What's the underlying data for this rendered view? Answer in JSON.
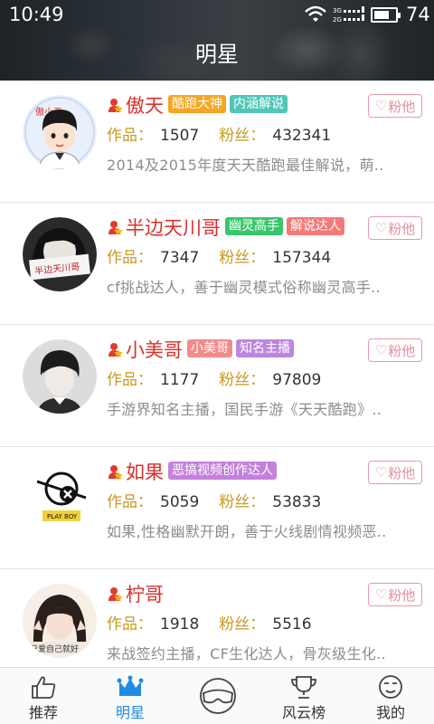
{
  "status_bar": {
    "time": "10:49",
    "network": "3G 2G",
    "battery": "74",
    "battery_level": 0.74
  },
  "header": {
    "title": "明星"
  },
  "stars": [
    {
      "name": "傲天",
      "tags": [
        {
          "label": "酷跑大神",
          "color": "#f5a623"
        },
        {
          "label": "内涵解说",
          "color": "#4fc6b8"
        }
      ],
      "works_label": "作品：",
      "works": "1507",
      "fans_label": "粉丝：",
      "fans": "432341",
      "desc": "2014及2015年度天天酷跑最佳解说，萌..",
      "fan_button": "粉他"
    },
    {
      "name": "半边天川哥",
      "tags": [
        {
          "label": "幽灵高手",
          "color": "#39c66c"
        },
        {
          "label": "解说达人",
          "color": "#f27a7a"
        }
      ],
      "works_label": "作品：",
      "works": "7347",
      "fans_label": "粉丝：",
      "fans": "157344",
      "desc": "cf挑战达人，善于幽灵模式俗称幽灵高手..",
      "fan_button": "粉他"
    },
    {
      "name": "小美哥",
      "tags": [
        {
          "label": "小美哥",
          "color": "#f28b8b"
        },
        {
          "label": "知名主播",
          "color": "#bb86dd"
        }
      ],
      "works_label": "作品：",
      "works": "1177",
      "fans_label": "粉丝：",
      "fans": "97809",
      "desc": "手游界知名主播，国民手游《天天酷跑》..",
      "fan_button": "粉他"
    },
    {
      "name": "如果",
      "tags": [
        {
          "label": "恶搞视频创作达人",
          "color": "#c481dc"
        }
      ],
      "works_label": "作品：",
      "works": "5059",
      "fans_label": "粉丝：",
      "fans": "53833",
      "desc": "如果,性格幽默开朗，善于火线剧情视频恶..",
      "fan_button": "粉他"
    },
    {
      "name": "柠哥",
      "tags": [],
      "works_label": "作品：",
      "works": "1918",
      "fans_label": "粉丝：",
      "fans": "5516",
      "desc": "来战签约主播，CF生化达人，骨灰级生化..",
      "fan_button": "粉他"
    }
  ],
  "avatar_texts": {
    "aotian": "傲小天",
    "chuange": "半边天川哥",
    "ruguo": "PLAY BOY",
    "ningge": "己爱自己就好"
  },
  "tabs": [
    {
      "label": "推荐",
      "icon": "thumbs-up-icon",
      "active": false
    },
    {
      "label": "明星",
      "icon": "crown-icon",
      "active": true
    },
    {
      "label": "",
      "icon": "goggles-icon",
      "active": false
    },
    {
      "label": "风云榜",
      "icon": "trophy-icon",
      "active": false
    },
    {
      "label": "我的",
      "icon": "face-icon",
      "active": false
    }
  ],
  "colors": {
    "name": "#d9312b",
    "label": "#c99a1e",
    "accent": "#1f8be6",
    "fan_button": "#e58f9d"
  }
}
